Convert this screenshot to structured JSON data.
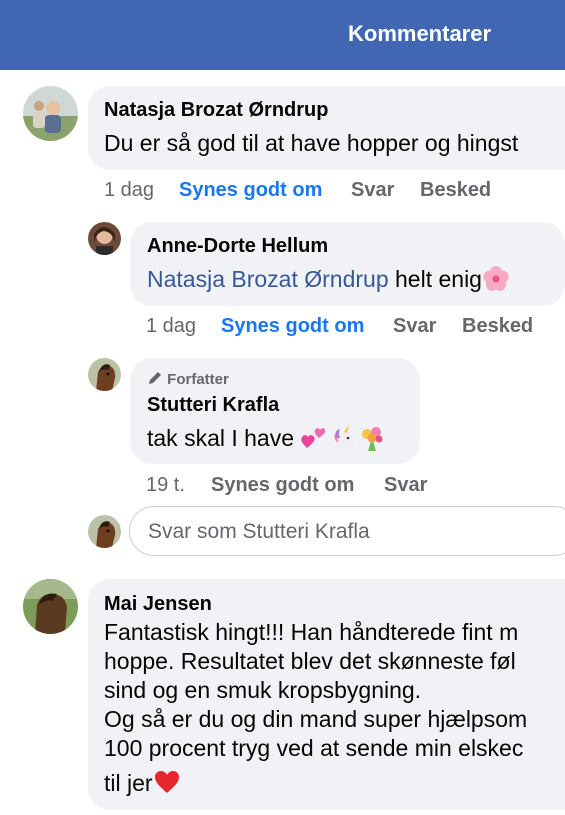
{
  "header": {
    "title": "Kommentarer"
  },
  "comments": [
    {
      "author": "Natasja Brozat Ørndrup",
      "text": "Du er så god til at have hopper og hingst",
      "time": "1 dag",
      "like": "Synes godt om",
      "reply": "Svar",
      "message": "Besked",
      "replies": [
        {
          "author": "Anne-Dorte Hellum",
          "mention": "Natasja Brozat Ørndrup",
          "text": " helt enig",
          "time": "1 dag",
          "like": "Synes godt om",
          "reply": "Svar",
          "message": "Besked"
        },
        {
          "badge": "Forfatter",
          "author": "Stutteri Krafla",
          "text": "tak skal I have ",
          "time": "19 t.",
          "like": "Synes godt om",
          "reply": "Svar"
        }
      ],
      "reply_input": {
        "placeholder": "Svar som Stutteri Krafla"
      }
    },
    {
      "author": "Mai Jensen",
      "lines": [
        "Fantastisk hingt!!! Han håndterede fint m",
        "hoppe.  Resultatet blev det skønneste føl",
        "sind og en smuk kropsbygning.",
        "Og så er du og din mand super hjælpsom",
        "100 procent tryg ved at sende min elskec",
        "til jer"
      ]
    }
  ],
  "icons": {
    "flower": "cherry-blossom-icon",
    "hearts": "two-hearts-icon",
    "unicorn": "unicorn-icon",
    "bouquet": "bouquet-icon",
    "heart": "red-heart-icon",
    "pencil": "pencil-icon"
  },
  "colors": {
    "header": "#4267b2",
    "liked": "#1877f2",
    "mention": "#385898",
    "bubble": "#f0f2f5"
  }
}
